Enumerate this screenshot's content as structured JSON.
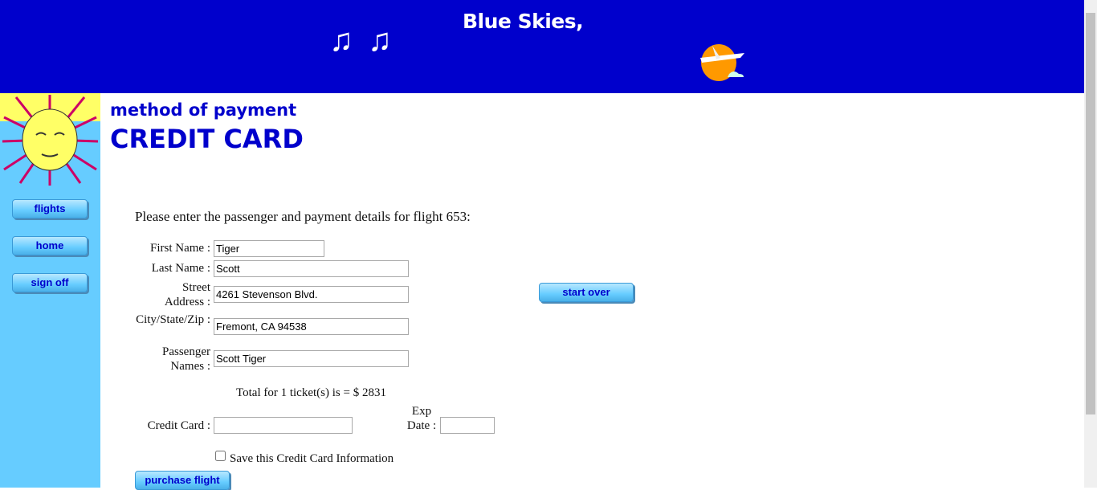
{
  "header": {
    "brand": "Blue Skies,",
    "icons": [
      "music-notes-icon",
      "airplane-sun-icon"
    ]
  },
  "sidebar": {
    "items": [
      {
        "label": "flights"
      },
      {
        "label": "home"
      },
      {
        "label": "sign off"
      }
    ]
  },
  "page": {
    "subtitle": "method of payment",
    "title": "CREDIT CARD",
    "intro": "Please enter the passenger and payment details for flight 653:"
  },
  "form": {
    "first_name": {
      "label": "First Name :",
      "value": "Tiger"
    },
    "last_name": {
      "label": "Last Name :",
      "value": "Scott"
    },
    "street": {
      "label": "Street Address :",
      "value": "4261 Stevenson Blvd."
    },
    "city": {
      "label": "City/State/Zip :",
      "value": "Fremont, CA 94538"
    },
    "passengers": {
      "label": "Passenger Names :",
      "value": "Scott Tiger"
    },
    "total": "Total for 1 ticket(s) is = $ 2831",
    "credit_card": {
      "label": "Credit Card :",
      "value": ""
    },
    "exp_date": {
      "label": "Exp Date :",
      "value": ""
    },
    "save_card": {
      "label": "Save this Credit Card Information",
      "checked": false
    },
    "purchase": "purchase flight",
    "start_over": "start over"
  }
}
